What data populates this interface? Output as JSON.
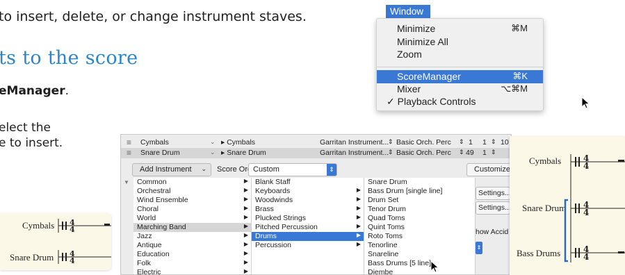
{
  "doc": {
    "intro_line": "to insert, delete, or change instrument staves.",
    "heading": "ts to the score",
    "step_bold": "eManager",
    "step_end": ".",
    "select_line1": "elect the",
    "select_line2": "e to insert."
  },
  "window_menu": {
    "title": "Window",
    "items": [
      {
        "label": "Minimize",
        "shortcut": "⌘M"
      },
      {
        "label": "Minimize All",
        "shortcut": ""
      },
      {
        "label": "Zoom",
        "shortcut": ""
      },
      {
        "label": "ScoreManager",
        "shortcut": "⌘K",
        "selected": true
      },
      {
        "label": "Mixer",
        "shortcut": "⌥⌘M"
      },
      {
        "label": "✓ Playback Controls",
        "shortcut": ""
      }
    ]
  },
  "score_manager": {
    "rows": [
      {
        "name": "Cymbals",
        "staff": "▸ Cymbals",
        "sound": "Garritan Instrument...",
        "perc": "Basic Orch. Perc",
        "n1": "1",
        "n2": "1",
        "n3": "10"
      },
      {
        "name": "Snare Drum",
        "staff": "▸ Snare Drum",
        "sound": "Garritan Instrument...",
        "perc": "Basic Orch. Perc",
        "n1": "49",
        "n2": "1",
        "n3": ""
      }
    ],
    "add_instrument": "Add Instrument",
    "score_order_label": "Score Order:",
    "score_order_value": "Custom",
    "customize": "Customize V",
    "col1": [
      "Common",
      "Orchestral",
      "Wind Ensemble",
      "Choral",
      "World",
      "Marching Band",
      "Jazz",
      "Antique",
      "Education",
      "Folk",
      "Electric"
    ],
    "col1_selected": 5,
    "col2": [
      "Blank Staff",
      "Keyboards",
      "Woodwinds",
      "Brass",
      "Plucked Strings",
      "Pitched Percussion",
      "Drums",
      "Percussion"
    ],
    "col2_selected": 6,
    "col3": [
      "Snare Drum",
      "Bass Drum [single line]",
      "Drum Set",
      "Tenor Drum",
      "Quad Toms",
      "Quint Toms",
      "Roto Toms",
      "Tenorline",
      "Snareline",
      "Bass Drums [5 line]",
      "Djembe"
    ],
    "settings1": "Settings...",
    "settings2": "Settings...",
    "show_acc": "how Accid"
  },
  "score_left": {
    "staff1": "Cymbals",
    "staff2": "Snare Drum"
  },
  "score_right": {
    "staff1": "Cymbals",
    "staff2": "Snare Drum",
    "staff3": "Bass Drums"
  },
  "colors": {
    "accent": "#3a78d6",
    "heading": "#2a86c8",
    "score_bg": "#fbf8e8"
  }
}
